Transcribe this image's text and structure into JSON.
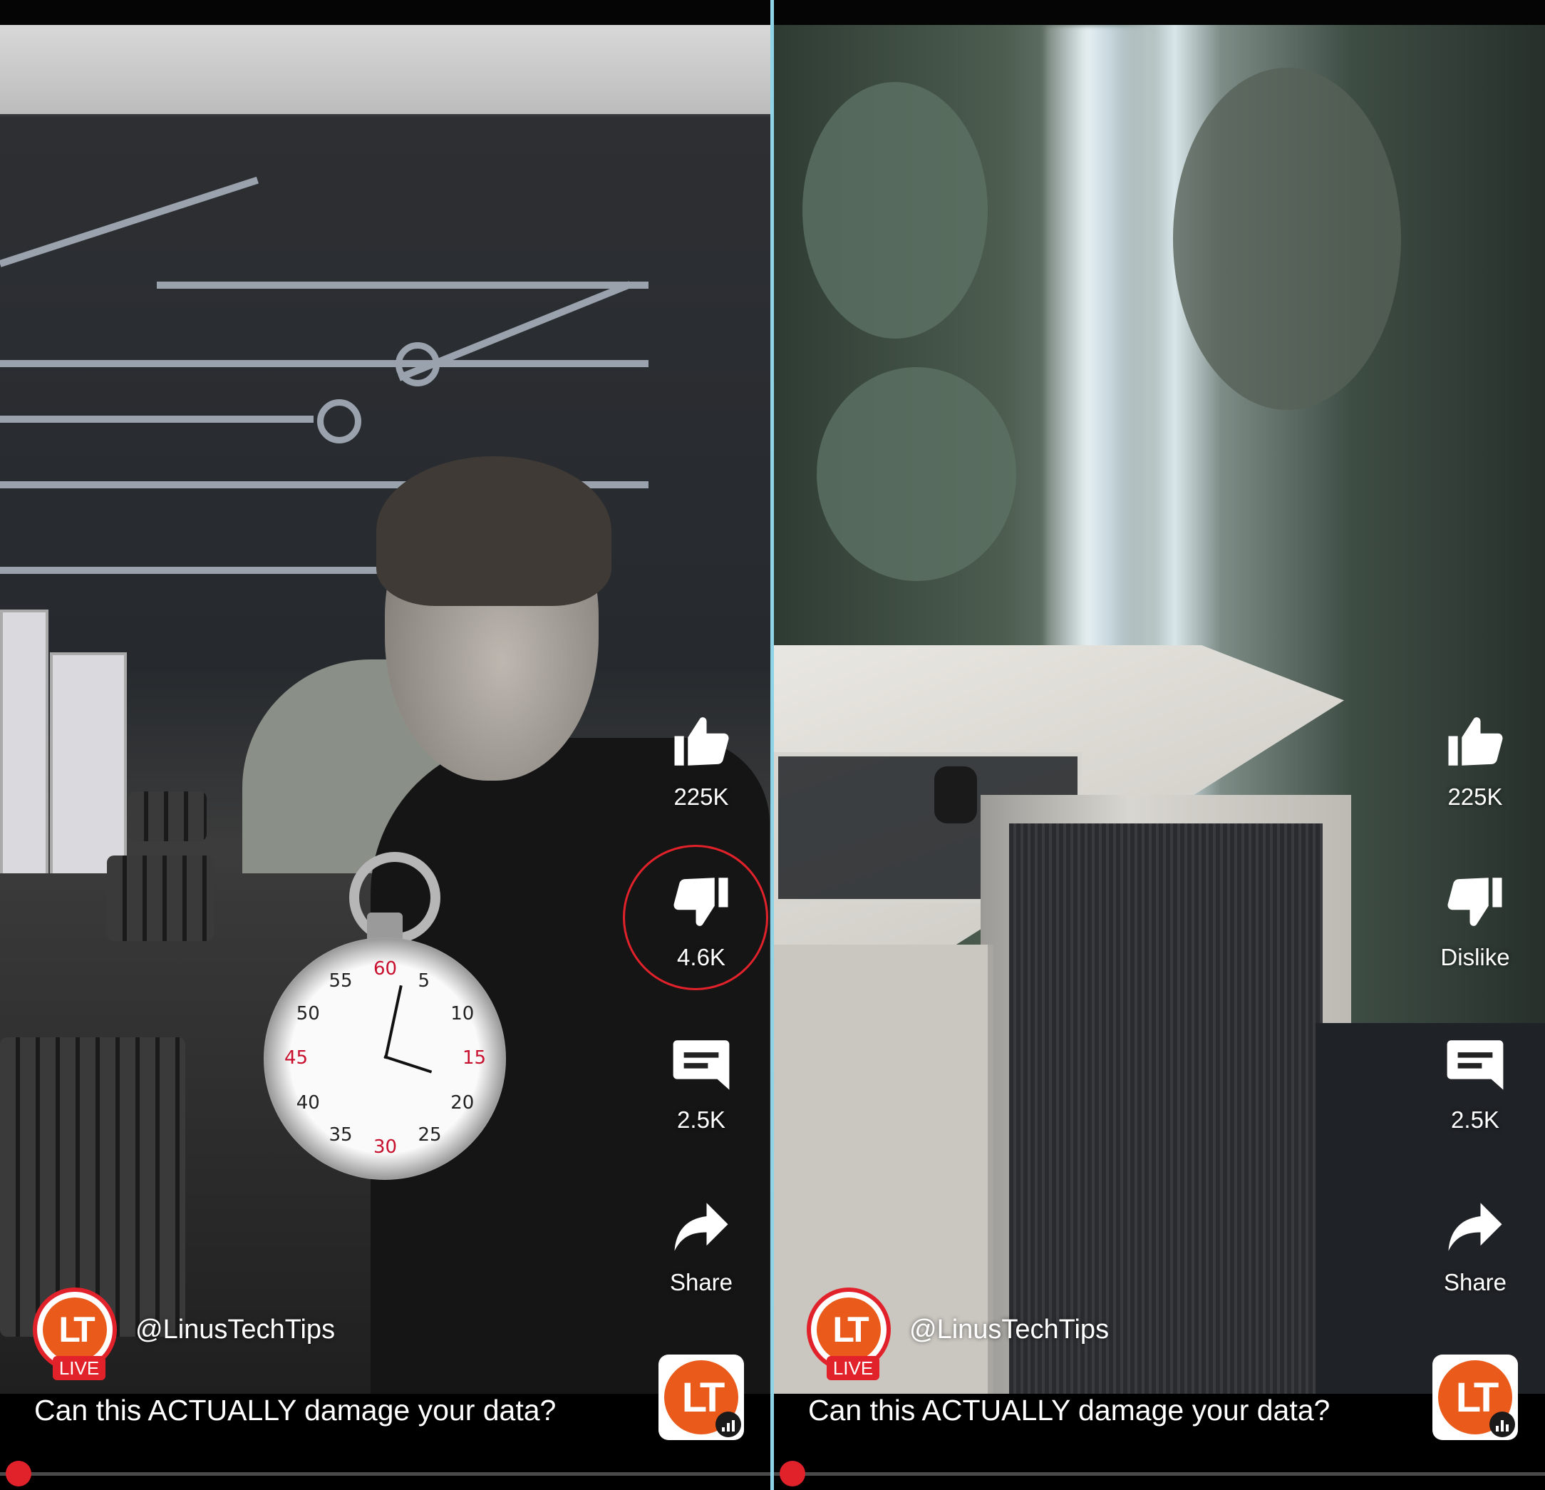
{
  "panels": [
    {
      "like_count": "225K",
      "dislike_label": "4.6K",
      "comment_count": "2.5K",
      "share_label": "Share",
      "live_badge": "LIVE",
      "channel_handle": "@LinusTechTips",
      "video_title": "Can this ACTUALLY damage your data?",
      "progress": 0.0
    },
    {
      "like_count": "225K",
      "dislike_label": "Dislike",
      "comment_count": "2.5K",
      "share_label": "Share",
      "live_badge": "LIVE",
      "channel_handle": "@LinusTechTips",
      "video_title": "Can this ACTUALLY damage your data?",
      "progress": 0.0
    }
  ],
  "stopwatch": {
    "numbers": [
      "60",
      "5",
      "10",
      "15",
      "20",
      "25",
      "30",
      "35",
      "40",
      "45",
      "50",
      "55"
    ]
  },
  "colors": {
    "accent_red": "#e2222b",
    "brand_orange": "#ea5b1b",
    "divider": "#8fd3e6"
  },
  "icons": {
    "like": "thumbs-up-icon",
    "dislike": "thumbs-down-icon",
    "comment": "comment-icon",
    "share": "share-arrow-icon",
    "channel_logo": "ltt-logo",
    "audio": "equalizer-icon"
  }
}
